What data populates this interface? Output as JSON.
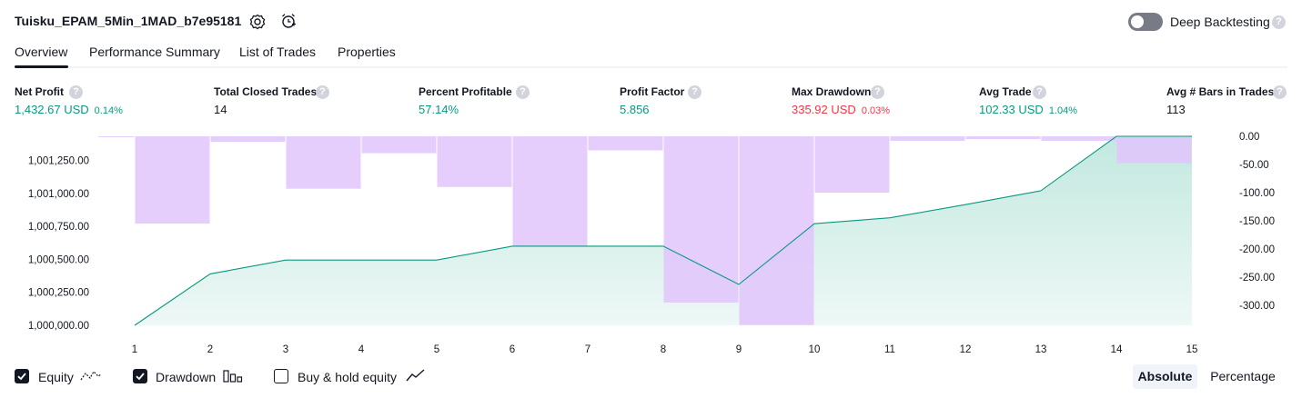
{
  "header": {
    "title": "Tuisku_EPAM_5Min_1MAD_b7e95181",
    "deep_backtesting_label": "Deep Backtesting",
    "help_glyph": "?",
    "icons": [
      "settings-icon",
      "add-alert-icon",
      "help-icon"
    ]
  },
  "tabs": [
    {
      "label": "Overview",
      "active": true
    },
    {
      "label": "Performance Summary",
      "active": false
    },
    {
      "label": "List of Trades",
      "active": false
    },
    {
      "label": "Properties",
      "active": false
    }
  ],
  "stats": {
    "net_profit": {
      "label": "Net Profit",
      "value": "1,432.67 USD",
      "pct": "0.14%"
    },
    "total_closed_trades": {
      "label": "Total Closed Trades",
      "value": "14"
    },
    "percent_profitable": {
      "label": "Percent Profitable",
      "value": "57.14%"
    },
    "profit_factor": {
      "label": "Profit Factor",
      "value": "5.856"
    },
    "max_drawdown": {
      "label": "Max Drawdown",
      "value": "335.92 USD",
      "pct": "0.03%"
    },
    "avg_trade": {
      "label": "Avg Trade",
      "value": "102.33 USD",
      "pct": "1.04%"
    },
    "avg_bars": {
      "label": "Avg # Bars in Trades",
      "value": "113"
    }
  },
  "chart_data": {
    "type": "area",
    "x": [
      1,
      2,
      3,
      4,
      5,
      6,
      7,
      8,
      9,
      10,
      11,
      12,
      13,
      14,
      15
    ],
    "equity_series": {
      "name": "Equity",
      "values": [
        1000000,
        1000390,
        1000495,
        1000495,
        1000495,
        1000600,
        1000600,
        1000600,
        1000310,
        1000770,
        1000815,
        1000915,
        1001020,
        1001433,
        1001433
      ]
    },
    "drawdown_series": {
      "name": "Drawdown",
      "values": [
        -1,
        -155,
        -10,
        -93,
        -30,
        -90,
        -195,
        -25,
        -295,
        -335,
        -100,
        -8,
        -5,
        -8,
        -48
      ]
    },
    "left_ylim": [
      1000000,
      1001433
    ],
    "left_ticks": [
      "1,001,250.00",
      "1,001,000.00",
      "1,000,750.00",
      "1,000,500.00",
      "1,000,250.00",
      "1,000,000.00"
    ],
    "left_tick_values": [
      1001250,
      1001000,
      1000750,
      1000500,
      1000250,
      1000000
    ],
    "right_ticks": [
      "0.00",
      "-50.00",
      "-100.00",
      "-150.00",
      "-200.00",
      "-250.00",
      "-300.00"
    ],
    "right_tick_values": [
      0,
      -50,
      -100,
      -150,
      -200,
      -250,
      -300
    ],
    "colors": {
      "equity_line": "#089981",
      "equity_fill_top": "#c2e8df",
      "equity_fill_bottom": "#eef8f6",
      "drawdown_fill": "#e1c4fb",
      "drawdown_overlap": "#c8c4f0"
    }
  },
  "legend": {
    "equity": {
      "label": "Equity",
      "checked": true
    },
    "drawdown": {
      "label": "Drawdown",
      "checked": true
    },
    "buy_hold": {
      "label": "Buy & hold equity",
      "checked": false
    }
  },
  "view_buttons": {
    "absolute": "Absolute",
    "percentage": "Percentage"
  }
}
